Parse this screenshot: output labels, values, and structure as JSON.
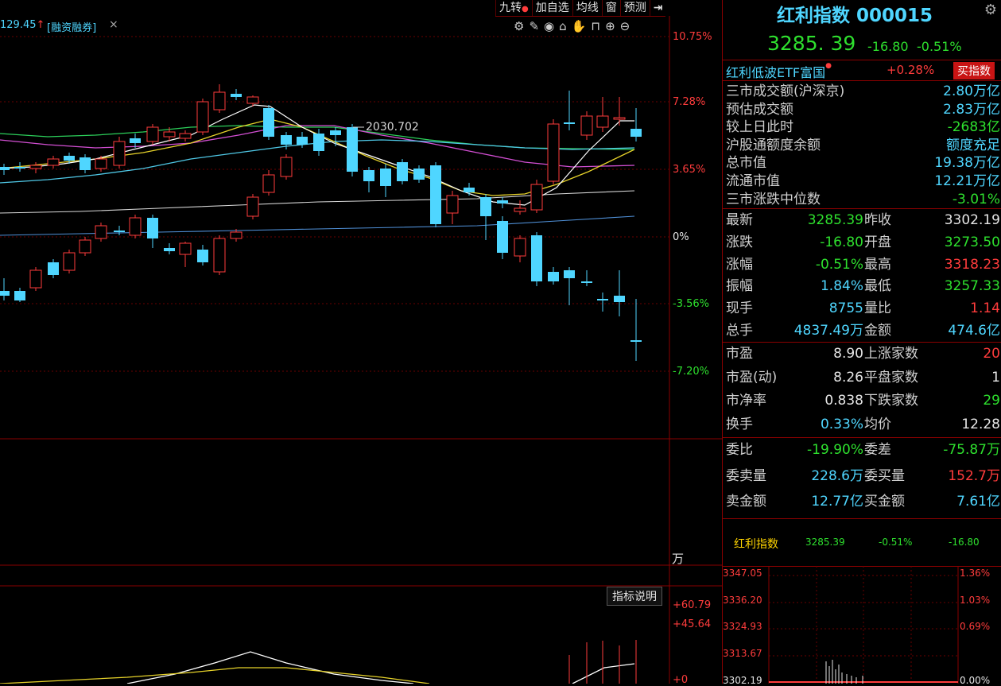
{
  "toolbar": {
    "items": [
      "九转",
      "加自选",
      "均线",
      "窗",
      "预测"
    ]
  },
  "main_chart": {
    "prev_value_label": "129.45",
    "margin_label": "融资融券",
    "close_label": "×",
    "annotation": "2030.702",
    "pct_labels": [
      "10.75%",
      "7.28%",
      "3.65%",
      "0%",
      "-3.56%",
      "-7.20%"
    ],
    "vol_unit": "万",
    "indicator_btn": "指标说明",
    "ind_labels": [
      "+60.79",
      "+45.64",
      "+0"
    ]
  },
  "panel": {
    "title": "红利指数 000015",
    "price": "3285. 39",
    "change": "-16.80",
    "change_pct": "-0.51%",
    "etf_name": "红利低波ETF富国",
    "etf_pct": "+0.28%",
    "buy_btn": "买指数",
    "market_rows": [
      {
        "k": "三市成交额(沪深京)",
        "v": "2.80万亿",
        "c": "cyan"
      },
      {
        "k": "预估成交额",
        "v": "2.83万亿",
        "c": "cyan"
      },
      {
        "k": "较上日此时",
        "v": "-2683亿",
        "c": "green"
      },
      {
        "k": "沪股通额度余额",
        "v": "额度充足",
        "c": "cyan"
      },
      {
        "k": "总市值",
        "v": "19.38万亿",
        "c": "cyan"
      },
      {
        "k": "流通市值",
        "v": "12.21万亿",
        "c": "cyan"
      },
      {
        "k": "三市涨跌中位数",
        "v": "-3.01%",
        "c": "green"
      }
    ],
    "quote_rows": [
      {
        "k1": "最新",
        "v1": "3285.39",
        "c1": "green",
        "k2": "昨收",
        "v2": "3302.19",
        "c2": "white"
      },
      {
        "k1": "涨跌",
        "v1": "-16.80",
        "c1": "green",
        "k2": "开盘",
        "v2": "3273.50",
        "c2": "green"
      },
      {
        "k1": "涨幅",
        "v1": "-0.51%",
        "c1": "green",
        "k2": "最高",
        "v2": "3318.23",
        "c2": "red"
      },
      {
        "k1": "振幅",
        "v1": "1.84%",
        "c1": "cyan",
        "k2": "最低",
        "v2": "3257.33",
        "c2": "green"
      },
      {
        "k1": "现手",
        "v1": "8755",
        "c1": "cyan",
        "k2": "量比",
        "v2": "1.14",
        "c2": "red"
      },
      {
        "k1": "总手",
        "v1": "4837.49万",
        "c1": "cyan",
        "k2": "金额",
        "v2": "474.6亿",
        "c2": "cyan"
      }
    ],
    "val_rows": [
      {
        "k1": "市盈",
        "v1": "8.90",
        "c1": "white",
        "k2": "上涨家数",
        "v2": "20",
        "c2": "red"
      },
      {
        "k1": "市盈(动)",
        "v1": "8.26",
        "c1": "white",
        "k2": "平盘家数",
        "v2": "1",
        "c2": "white"
      },
      {
        "k1": "市净率",
        "v1": "0.838",
        "c1": "white",
        "k2": "下跌家数",
        "v2": "29",
        "c2": "green"
      },
      {
        "k1": "换手",
        "v1": "0.33%",
        "c1": "cyan",
        "k2": "均价",
        "v2": "12.28",
        "c2": "white"
      }
    ],
    "order_rows": [
      {
        "k1": "委比",
        "v1": "-19.90%",
        "c1": "green",
        "k2": "委差",
        "v2": "-75.87万",
        "c2": "green"
      },
      {
        "k1": "委卖量",
        "v1": "228.6万",
        "c1": "cyan",
        "k2": "委买量",
        "v2": "152.7万",
        "c2": "red"
      },
      {
        "k1": "卖金额",
        "v1": "12.77亿",
        "c1": "cyan",
        "k2": "买金额",
        "v2": "7.61亿",
        "c2": "cyan"
      }
    ],
    "mini_strip": {
      "name": "红利指数",
      "price": "3285.39",
      "pct": "-0.51%",
      "chg": "-16.80"
    },
    "mini_left_labels": [
      "3347.05",
      "3336.20",
      "3324.93",
      "3313.67",
      "3302.19"
    ],
    "mini_right_labels": [
      "1.36%",
      "1.03%",
      "0.69%",
      "0.00%"
    ]
  }
}
